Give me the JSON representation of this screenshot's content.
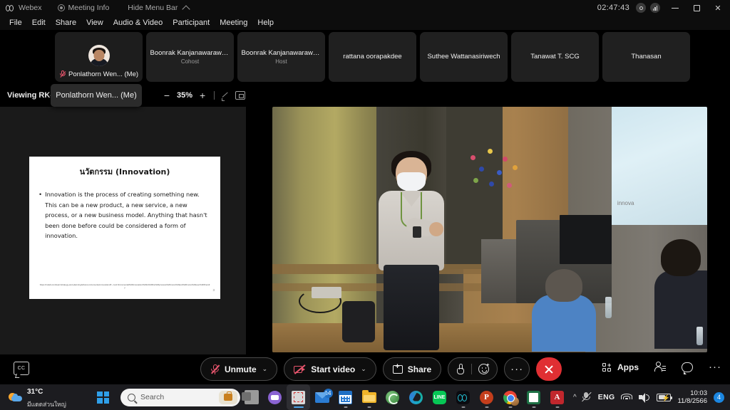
{
  "titlebar": {
    "app_name": "Webex",
    "meeting_info": "Meeting Info",
    "hide_menu_bar": "Hide Menu Bar",
    "timer": "02:47:43",
    "icons": {
      "webex_logo": "webex-logo-icon",
      "meeting_info": "info-circle-icon",
      "collapse": "chevron-up-icon",
      "recording": "record-circle-icon",
      "network": "network-quality-icon",
      "minimize": "minimize-icon",
      "maximize": "maximize-icon",
      "close": "close-icon"
    }
  },
  "menubar": {
    "items": [
      {
        "label": "File"
      },
      {
        "label": "Edit"
      },
      {
        "label": "Share"
      },
      {
        "label": "View"
      },
      {
        "label": "Audio & Video"
      },
      {
        "label": "Participant"
      },
      {
        "label": "Meeting"
      },
      {
        "label": "Help"
      }
    ]
  },
  "filmstrip": {
    "participants": [
      {
        "name": "Ponlathorn Wen... (Me)",
        "role": "",
        "self": true,
        "muted": true
      },
      {
        "name": "Boonrak Kanjanawarawa...",
        "role": "Cohost",
        "self": false,
        "muted": false
      },
      {
        "name": "Boonrak Kanjanawarawa...",
        "role": "Host",
        "self": false,
        "muted": false
      },
      {
        "name": "rattana oorapakdee",
        "role": "",
        "self": false,
        "muted": false
      },
      {
        "name": "Suthee Wattanasiriwech",
        "role": "",
        "self": false,
        "muted": false
      },
      {
        "name": "Tanawat T. SCG",
        "role": "",
        "self": false,
        "muted": false
      },
      {
        "name": "Thanasan",
        "role": "",
        "self": false,
        "muted": false
      }
    ]
  },
  "viewbar": {
    "viewing_label": "Viewing RK-I",
    "tooltip": "Ponlathorn Wen... (Me)",
    "zoom_out": "−",
    "zoom_level": "35%",
    "zoom_in": "+",
    "annotate_icon": "pen-annotate-icon",
    "fit_icon": "fit-to-screen-icon"
  },
  "slide": {
    "title": "นวัตกรรม (Innovation)",
    "bullet": "•",
    "body": "Innovation is the process of creating something new. This can be a new product, a new service, a new process, or a new business model. Anything that hasn't been done before could be considered a form of innovation.",
    "footnote": "https://nulab.com/learn/strategy-and-planning/what-is-incremental-innovation/#:~:text=Incremental%20innovation%20is%20the%20process%20more%20and%20more%20user%2Dfriendly",
    "page_number": "3"
  },
  "video": {
    "screen_text": "innova"
  },
  "controlbar": {
    "cc_label": "CC",
    "mute_button": "Unmute",
    "video_button": "Start video",
    "share_button": "Share",
    "apps_label": "Apps",
    "chevron": "⌄",
    "more": "···",
    "icons": {
      "cc": "closed-caption-icon",
      "mic_muted": "mic-muted-icon",
      "camera_off": "camera-off-icon",
      "share": "share-screen-icon",
      "reactions_hand": "raise-hand-icon",
      "reactions_smiley": "reactions-smiley-icon",
      "more": "more-options-icon",
      "end_call": "end-meeting-icon",
      "apps": "apps-grid-icon",
      "participants": "participants-icon",
      "chat": "chat-bubble-icon",
      "more_right": "more-icon"
    }
  },
  "taskbar": {
    "weather_temp": "31°C",
    "weather_desc": "มีแดดส่วนใหญ่",
    "search_placeholder": "Search",
    "apps": [
      {
        "name": "task-view",
        "label": "Task View"
      },
      {
        "name": "webex-meetings",
        "label": "Webex Meetings"
      },
      {
        "name": "snipping-tool",
        "label": "Snipping Tool",
        "active": true
      },
      {
        "name": "mail",
        "label": "Mail",
        "badge": "14"
      },
      {
        "name": "calendar",
        "label": "Calendar"
      },
      {
        "name": "file-explorer",
        "label": "File Explorer"
      },
      {
        "name": "xbox",
        "label": "Xbox"
      },
      {
        "name": "edge",
        "label": "Microsoft Edge"
      },
      {
        "name": "line",
        "label": "LINE"
      },
      {
        "name": "webex",
        "label": "Webex"
      },
      {
        "name": "powerpoint",
        "label": "PowerPoint"
      },
      {
        "name": "chrome",
        "label": "Google Chrome"
      },
      {
        "name": "excel",
        "label": "Excel"
      },
      {
        "name": "acrobat",
        "label": "Adobe Acrobat"
      }
    ],
    "line_label": "LINE",
    "ppt_label": "P",
    "acrobat_label": "A",
    "tray": {
      "language": "ENG",
      "time": "10:03",
      "date": "11/8/2566",
      "notification_count": "4",
      "icons": {
        "mic_muted": "mic-muted-tray-icon",
        "wifi": "wifi-icon",
        "speaker": "speaker-icon",
        "battery": "battery-charging-icon",
        "overflow": "show-hidden-icons-icon"
      }
    }
  }
}
